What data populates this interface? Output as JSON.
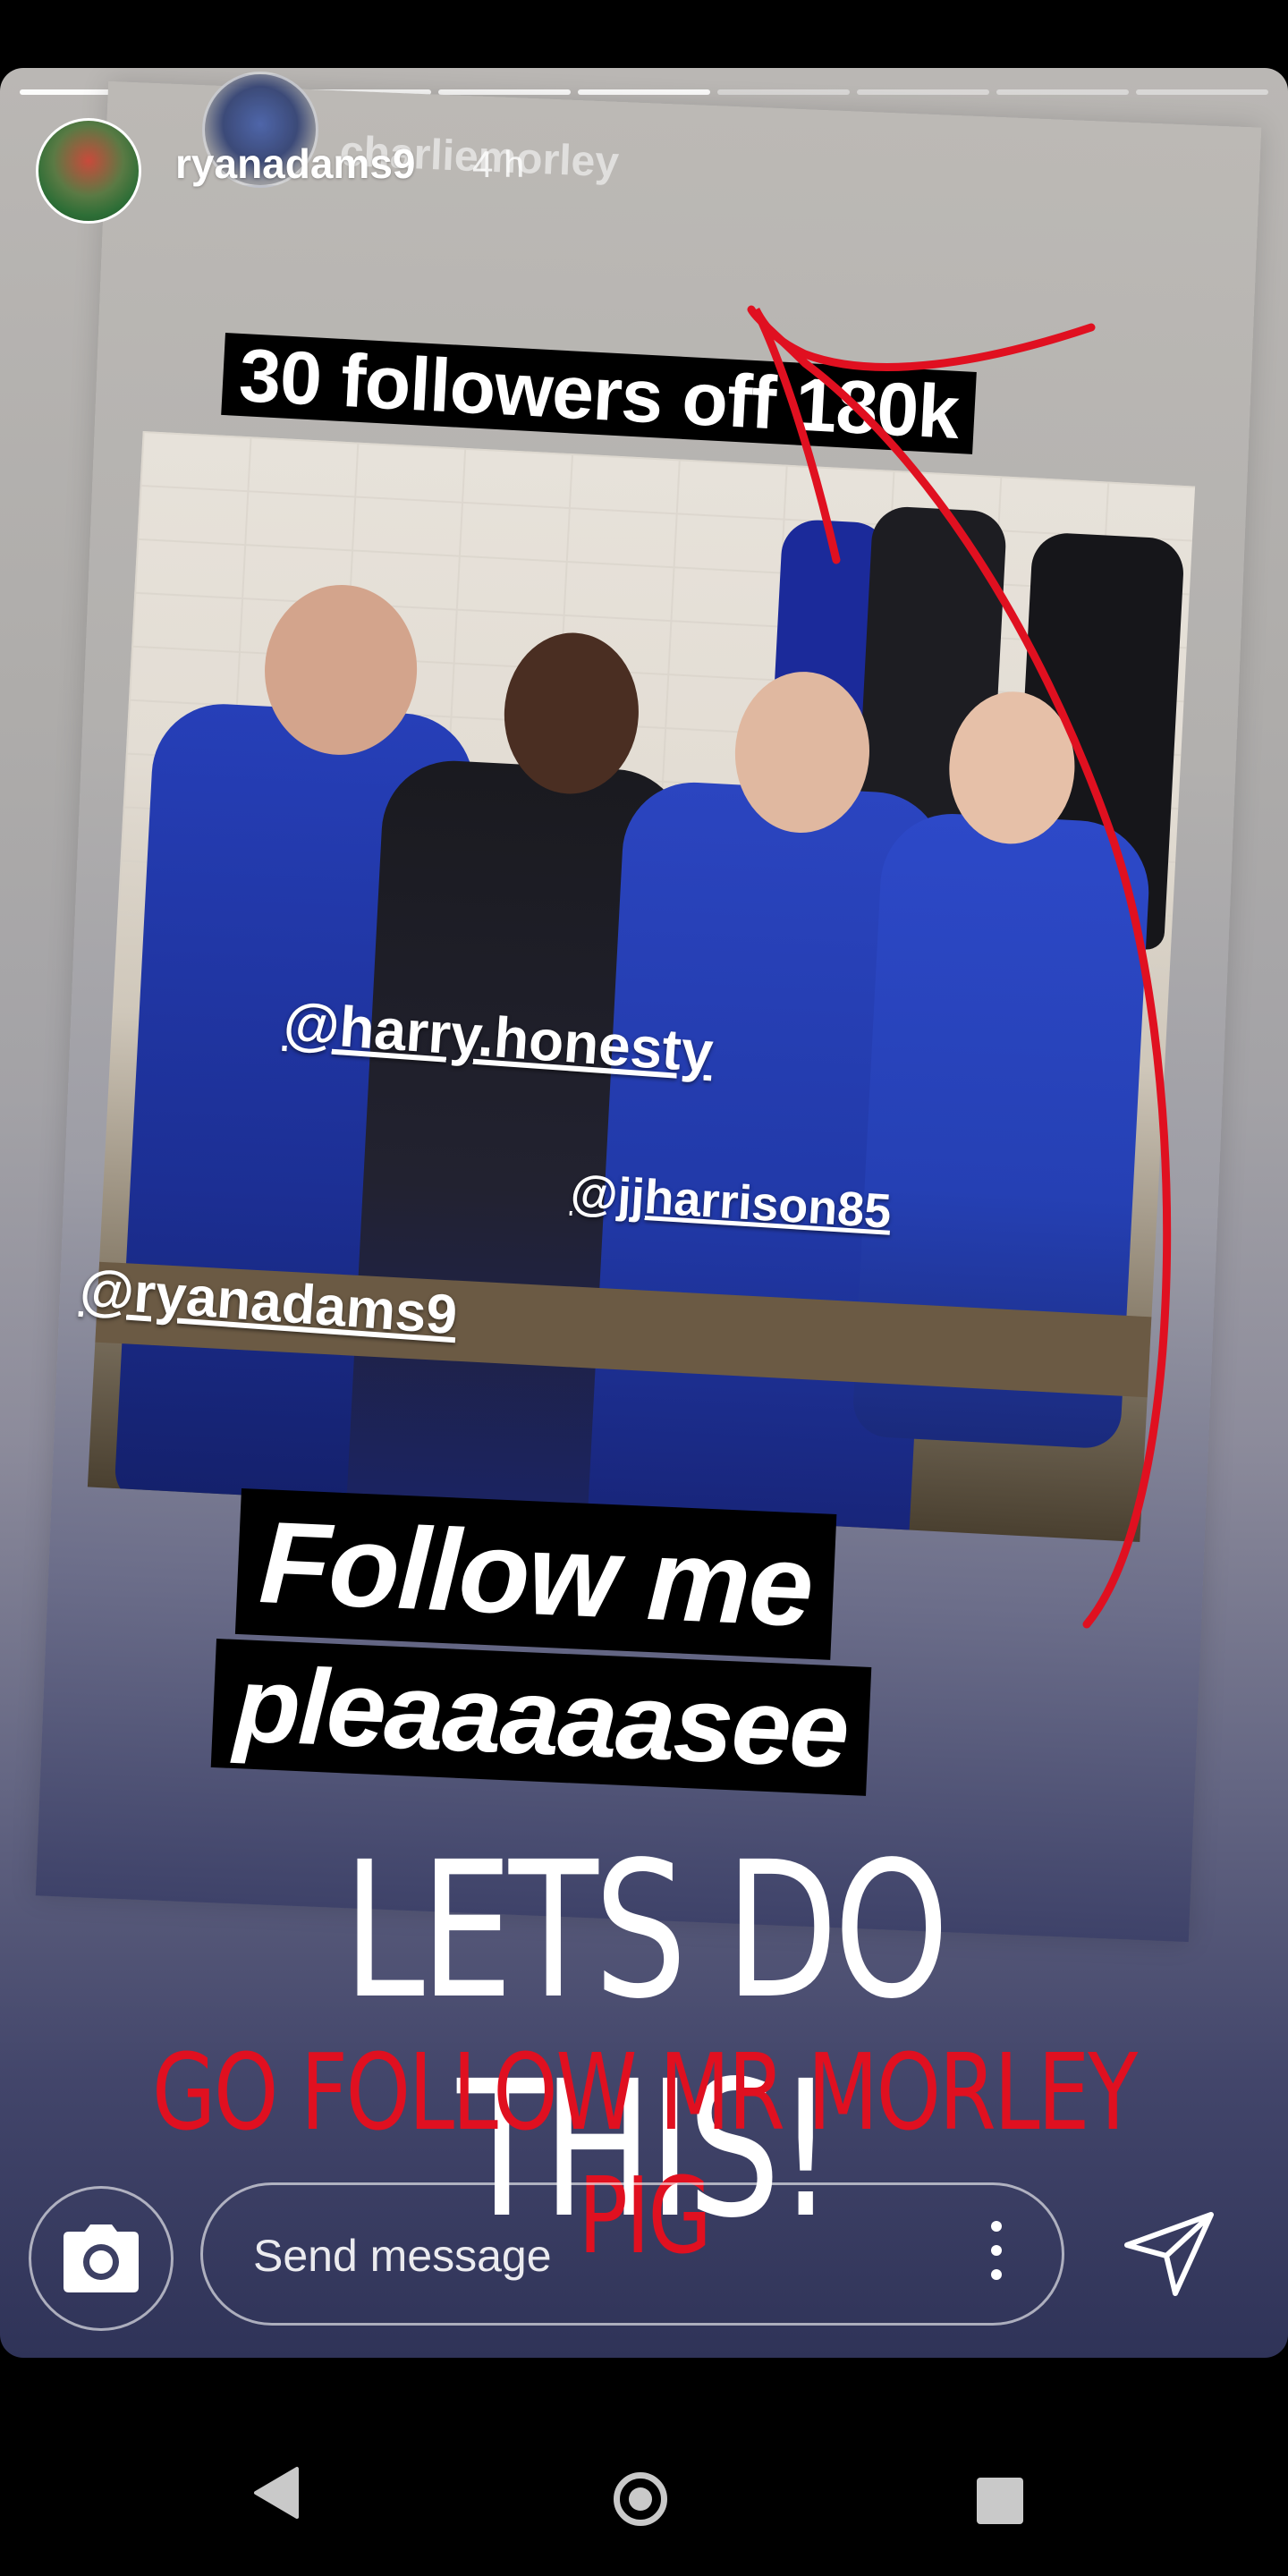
{
  "story": {
    "progress_segments": 9,
    "progress_completed": 5,
    "username": "ryanadams9",
    "time": "4 h",
    "reshared_from": "charliemorley"
  },
  "stickers": {
    "top": "30 followers off 180k",
    "follow": "Follow me",
    "please": "pleaaaaasee"
  },
  "tags": {
    "harry": "@harry.honesty",
    "jj": "@jjharrison85",
    "ryan": "@ryanadams9"
  },
  "headline": "LETS DO THIS!",
  "subheadline": "GO FOLLOW MR MORLEY PIG",
  "reply": {
    "placeholder": "Send message"
  },
  "icons": {
    "camera": "camera-icon",
    "more": "more-vertical-icon",
    "send": "send-icon",
    "back": "nav-back-icon",
    "home": "nav-home-icon",
    "recents": "nav-recents-icon"
  },
  "colors": {
    "sub_headline": "#e01020",
    "drawing_stroke": "#e01020"
  }
}
